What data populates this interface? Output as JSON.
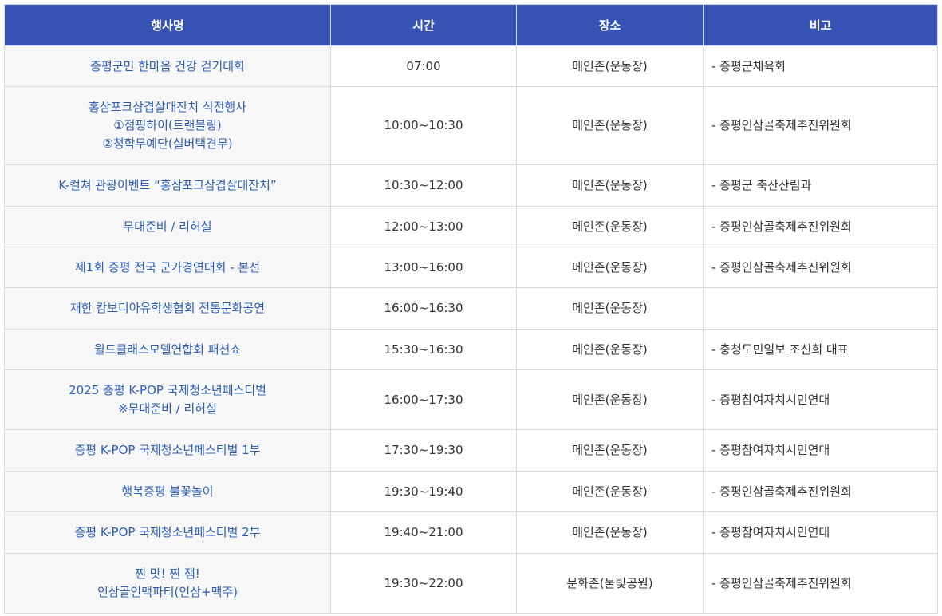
{
  "table": {
    "headers": [
      "행사명",
      "시간",
      "장소",
      "비고"
    ],
    "rows": [
      {
        "name": [
          "증평군민 한마음 건강 걷기대회"
        ],
        "time": "07:00",
        "place": "메인존(운동장)",
        "note": "- 증평군체육회"
      },
      {
        "name": [
          "홍삼포크삼겹살대잔치 식전행사",
          "①점핑하이(트랜블링)",
          "②청학무예단(실버택견무)"
        ],
        "time": "10:00~10:30",
        "place": "메인존(운동장)",
        "note": "- 증평인삼골축제추진위원회"
      },
      {
        "name": [
          "K-컬쳐 관광이벤트 “홍삼포크삼겹살대잔치”"
        ],
        "time": "10:30~12:00",
        "place": "메인존(운동장)",
        "note": "- 증평군 축산산림과"
      },
      {
        "name": [
          "무대준비 / 리허설"
        ],
        "time": "12:00~13:00",
        "place": "메인존(운동장)",
        "note": "- 증평인삼골축제추진위원회"
      },
      {
        "name": [
          "제1회 증평 전국 군가경연대회 - 본선"
        ],
        "time": "13:00~16:00",
        "place": "메인존(운동장)",
        "note": "- 증평인삼골축제추진위원회"
      },
      {
        "name": [
          "재한 캄보디아유학생협회 전통문화공연"
        ],
        "time": "16:00~16:30",
        "place": "메인존(운동장)",
        "note": ""
      },
      {
        "name": [
          "월드클래스모델연합회 패션쇼"
        ],
        "time": "15:30~16:30",
        "place": "메인존(운동장)",
        "note": "- 충청도민일보 조신희 대표"
      },
      {
        "name": [
          "2025 증평 K-POP 국제청소년페스티벌",
          "※무대준비 / 리허설"
        ],
        "time": "16:00~17:30",
        "place": "메인존(운동장)",
        "note": "- 증평참여자치시민연대"
      },
      {
        "name": [
          "증평 K-POP 국제청소년페스티벌 1부"
        ],
        "time": "17:30~19:30",
        "place": "메인존(운동장)",
        "note": "- 증평참여자치시민연대"
      },
      {
        "name": [
          "행복증평 불꽃놀이"
        ],
        "time": "19:30~19:40",
        "place": "메인존(운동장)",
        "note": "- 증평인삼골축제추진위원회"
      },
      {
        "name": [
          "증평 K-POP 국제청소년페스티벌 2부"
        ],
        "time": "19:40~21:00",
        "place": "메인존(운동장)",
        "note": "- 증평참여자치시민연대"
      },
      {
        "name": [
          "찐 맛! 찐 잼!",
          "인삼골인맥파티(인삼+맥주)"
        ],
        "time": "19:30~22:00",
        "place": "문화존(물빛공원)",
        "note": "- 증평인삼골축제추진위원회"
      }
    ]
  }
}
